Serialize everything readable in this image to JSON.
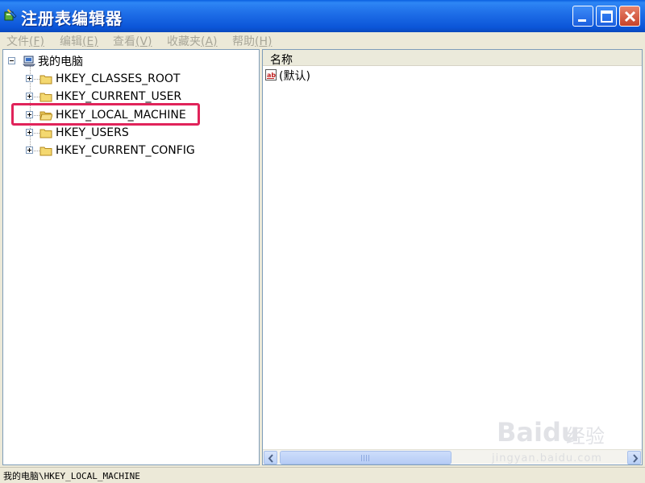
{
  "window": {
    "title": "注册表编辑器"
  },
  "menu": [
    {
      "label": "文件",
      "accel": "(F)"
    },
    {
      "label": "编辑",
      "accel": "(E)"
    },
    {
      "label": "查看",
      "accel": "(V)"
    },
    {
      "label": "收藏夹",
      "accel": "(A)"
    },
    {
      "label": "帮助",
      "accel": "(H)"
    }
  ],
  "tree": {
    "root": {
      "label": "我的电脑",
      "icon": "computer-icon",
      "expanded": true
    },
    "keys": [
      {
        "label": "HKEY_CLASSES_ROOT",
        "icon": "folder-icon"
      },
      {
        "label": "HKEY_CURRENT_USER",
        "icon": "folder-icon"
      },
      {
        "label": "HKEY_LOCAL_MACHINE",
        "icon": "folder-open-icon",
        "selected": true
      },
      {
        "label": "HKEY_USERS",
        "icon": "folder-icon"
      },
      {
        "label": "HKEY_CURRENT_CONFIG",
        "icon": "folder-icon"
      }
    ]
  },
  "list": {
    "column_name": "名称",
    "rows": [
      {
        "name": "(默认)",
        "icon": "string-value-icon"
      }
    ]
  },
  "statusbar": {
    "path": "我的电脑\\HKEY_LOCAL_MACHINE"
  },
  "watermark": {
    "brand": "Bai",
    "brand2": "du",
    "sub": "经验",
    "url": "jingyan.baidu.com"
  },
  "colors": {
    "titlebar": "#0B55D8",
    "highlight": "#E0235A",
    "pane_border": "#7F9DB9"
  }
}
